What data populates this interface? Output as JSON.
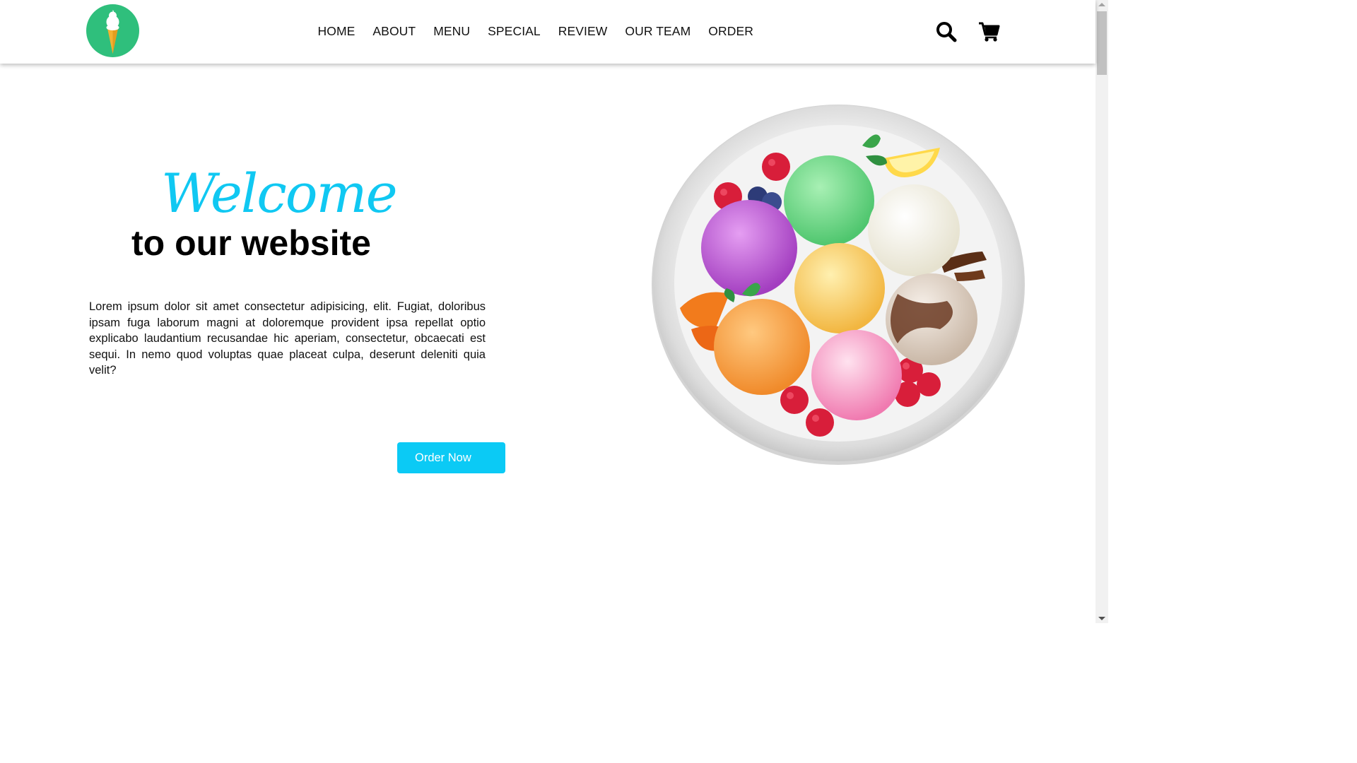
{
  "header": {
    "logo_icon": "ice-cream-cone-icon",
    "logo_bg": "#2fbf7c",
    "nav": [
      {
        "label": "HOME"
      },
      {
        "label": "ABOUT"
      },
      {
        "label": "MENU"
      },
      {
        "label": "SPECIAL"
      },
      {
        "label": "REVIEW"
      },
      {
        "label": "OUR TEAM"
      },
      {
        "label": "ORDER"
      }
    ],
    "icons": [
      "search-icon",
      "cart-icon"
    ]
  },
  "hero": {
    "welcome": "Welcome",
    "subtitle": "to our website",
    "description": "Lorem ipsum dolor sit amet consectetur adipisicing, elit. Fugiat, doloribus ipsam fuga laborum magni at doloremque provident ipsa repellat optio explicabo laudantium recusandae hic aperiam, consectetur, obcaecati est sequi. In nemo quod voluptas quae placeat culpa, deserunt deleniti quia velit?",
    "order_button": "Order Now",
    "accent_color": "#10c8f2",
    "image": "ice-cream-plate-image"
  }
}
